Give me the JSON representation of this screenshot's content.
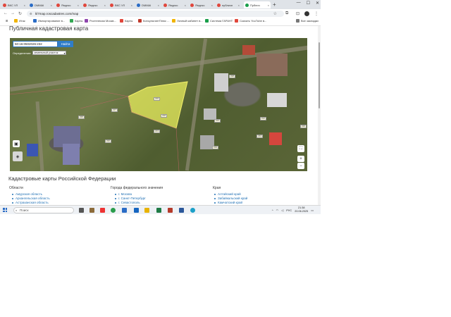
{
  "browser": {
    "tabs": [
      {
        "label": "ВКС УЛ",
        "color": "#e0473c"
      },
      {
        "label": "DMMAI",
        "color": "#2a6cc6"
      },
      {
        "label": "Яндекс",
        "color": "#e0473c"
      },
      {
        "label": "Яндекс",
        "color": "#e0473c"
      },
      {
        "label": "ВКС УЛ",
        "color": "#e0473c"
      },
      {
        "label": "DMMAI",
        "color": "#2a6cc6"
      },
      {
        "label": "Яндекс",
        "color": "#e0473c"
      },
      {
        "label": "Яндекс",
        "color": "#e0473c"
      },
      {
        "label": "публичн",
        "color": "#e0473c"
      },
      {
        "label": "Публич",
        "color": "#1a9e4a",
        "active": true
      }
    ],
    "new_tab": "+",
    "url": "kl7map.roscadastres.com/map",
    "bookmarks": [
      {
        "label": "Итак",
        "color": "#f0b400"
      },
      {
        "label": "Импортирование в...",
        "color": "#2a6cc6"
      },
      {
        "label": "Карты",
        "color": "#34a853"
      },
      {
        "label": "Ростелеком Москв...",
        "color": "#8e44ad"
      },
      {
        "label": "Карты",
        "color": "#e0473c"
      },
      {
        "label": "КонсультантПлюс ...",
        "color": "#c0392b"
      },
      {
        "label": "Личный кабинет в...",
        "color": "#f0b400"
      },
      {
        "label": "Система ГАРАНТ",
        "color": "#1a9e4a"
      },
      {
        "label": "Скачать YouTube в...",
        "color": "#e0473c"
      },
      {
        "label": "Все закладки",
        "color": "#777777"
      }
    ]
  },
  "page": {
    "title": "Публичная кадастровая карта",
    "search": {
      "value": "50:16:0502026:232",
      "button": "Найти",
      "definition_label": "Определение:",
      "definition_value": "земельный участок"
    },
    "map_controls": {
      "layers": "слои",
      "zoom_in": "+",
      "zoom_out": "−",
      "fullscreen": "⛶"
    },
    "parcel_labels": [
      "219",
      "218",
      "217",
      "226",
      "213",
      "220",
      "224",
      "228",
      "234",
      "219",
      "212",
      "226"
    ],
    "heading": "Кадастровые карты Российской Федерации",
    "columns": [
      {
        "title": "Области",
        "items": [
          "Амурская область",
          "Архангельская область",
          "Астраханская область"
        ]
      },
      {
        "title": "Города федерального значения",
        "items": [
          "г. Москва",
          "г. Санкт-Петербург",
          "г. Севастополь"
        ]
      },
      {
        "title": "Края",
        "items": [
          "Алтайский край",
          "Забайкальский край",
          "Камчатский край"
        ]
      }
    ]
  },
  "taskbar": {
    "search_placeholder": "Поиск",
    "language": "РУС",
    "time": "21:38",
    "date": "20.06.2025"
  }
}
